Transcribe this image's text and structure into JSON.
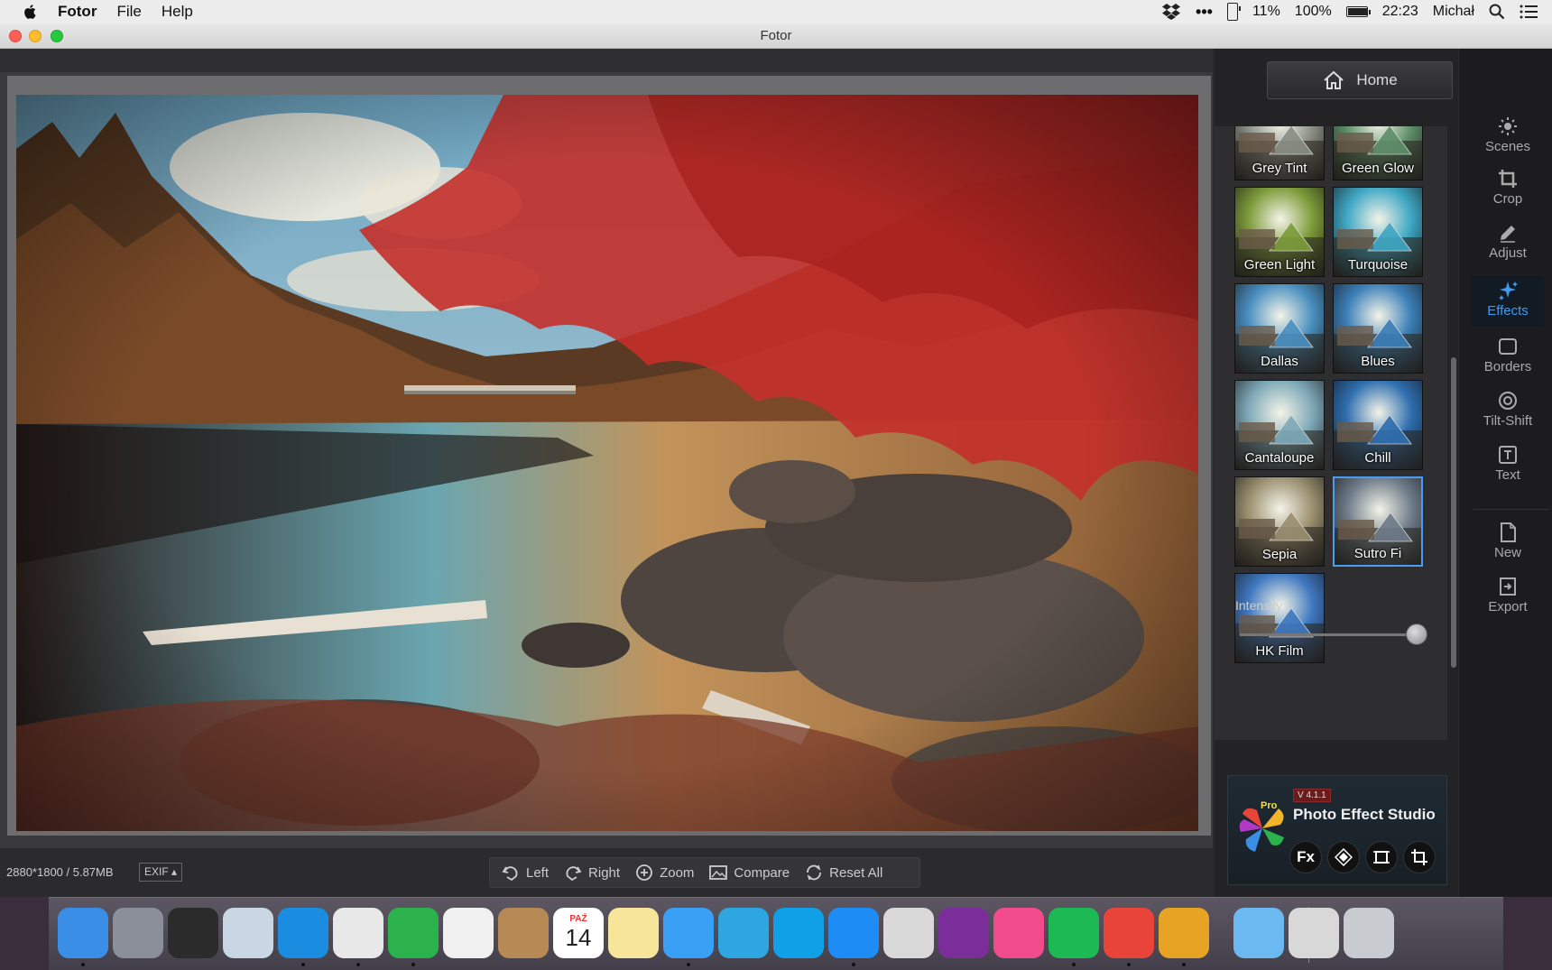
{
  "menubar": {
    "app_name": "Fotor",
    "menus": [
      "File",
      "Help"
    ],
    "battery_small": "11%",
    "battery": "100%",
    "battery_level": 1.0,
    "time": "22:23",
    "user": "Michał"
  },
  "window": {
    "title": "Fotor"
  },
  "status": {
    "image_info": "2880*1800 / 5.87MB",
    "exif_label": "EXIF ▴"
  },
  "tools": [
    {
      "label": "Left",
      "icon": "rotate-left-icon"
    },
    {
      "label": "Right",
      "icon": "rotate-right-icon"
    },
    {
      "label": "Zoom",
      "icon": "zoom-icon"
    },
    {
      "label": "Compare",
      "icon": "compare-icon"
    },
    {
      "label": "Reset All",
      "icon": "reset-icon"
    }
  ],
  "home_button": "Home",
  "effects": [
    {
      "label": "Grey Tint",
      "tint": "#8a8f86"
    },
    {
      "label": "Green Glow",
      "tint": "#5f8f6a"
    },
    {
      "label": "Green Light",
      "tint": "#7d9c3a"
    },
    {
      "label": "Turquoise",
      "tint": "#3fa7c4"
    },
    {
      "label": "Dallas",
      "tint": "#4a8fc0"
    },
    {
      "label": "Blues",
      "tint": "#3b7fb8"
    },
    {
      "label": "Cantaloupe",
      "tint": "#7fa9b8"
    },
    {
      "label": "Chill",
      "tint": "#2f6fb0"
    },
    {
      "label": "Sepia",
      "tint": "#9b9070"
    },
    {
      "label": "Sutro Fi",
      "tint": "#6f7c8a"
    },
    {
      "label": "HK Film",
      "tint": "#3f78c0"
    }
  ],
  "selected_effect": "Sutro Fi",
  "intensity": {
    "label": "Intensity",
    "value": 1.0
  },
  "promo": {
    "version": "V 4.1.1",
    "title": "Photo Effect Studio",
    "fx_label": "Fx"
  },
  "sidebar": [
    {
      "label": "Scenes",
      "icon": "sun-icon"
    },
    {
      "label": "Crop",
      "icon": "crop-icon"
    },
    {
      "label": "Adjust",
      "icon": "pencil-icon"
    },
    {
      "label": "Effects",
      "icon": "sparkle-icon"
    },
    {
      "label": "Borders",
      "icon": "border-icon"
    },
    {
      "label": "Tilt-Shift",
      "icon": "target-icon"
    },
    {
      "label": "Text",
      "icon": "text-icon"
    },
    {
      "label": "New",
      "icon": "document-icon"
    },
    {
      "label": "Export",
      "icon": "export-icon"
    }
  ],
  "active_sidebar": "Effects",
  "dock": {
    "calendar_month": "PAŹ",
    "calendar_day": "14",
    "apps": [
      {
        "name": "finder-icon",
        "color": "#3a8ee6"
      },
      {
        "name": "launchpad-icon",
        "color": "#8a8f99"
      },
      {
        "name": "mission-control-icon",
        "color": "#2b2b2b"
      },
      {
        "name": "mail-icon",
        "color": "#c9d6e3"
      },
      {
        "name": "safari-icon",
        "color": "#1b8de0"
      },
      {
        "name": "chrome-icon",
        "color": "#e8e8e8"
      },
      {
        "name": "feedly-icon",
        "color": "#2bb24c"
      },
      {
        "name": "pocket-icon",
        "color": "#f0f0f0"
      },
      {
        "name": "contacts-icon",
        "color": "#b78a55"
      },
      {
        "name": "calendar-icon",
        "color": "#ffffff"
      },
      {
        "name": "notes-icon",
        "color": "#f7e59a"
      },
      {
        "name": "messages-icon",
        "color": "#3aa0f5"
      },
      {
        "name": "telegram-icon",
        "color": "#2ea6df"
      },
      {
        "name": "skype-icon",
        "color": "#0fa0e8"
      },
      {
        "name": "messenger-icon",
        "color": "#1e8cf5"
      },
      {
        "name": "preview-icon",
        "color": "#d9d9d9"
      },
      {
        "name": "onenote-icon",
        "color": "#7b2e9a"
      },
      {
        "name": "itunes-icon",
        "color": "#f24b8c"
      },
      {
        "name": "spotify-icon",
        "color": "#1db954"
      },
      {
        "name": "downloader-icon",
        "color": "#e8443a"
      },
      {
        "name": "colors-icon",
        "color": "#e6a324"
      },
      {
        "name": "folder-icon",
        "color": "#6cb8f0"
      },
      {
        "name": "downloads-stack-icon",
        "color": "#d8d8d8"
      },
      {
        "name": "trash-icon",
        "color": "#c8ccd0"
      }
    ]
  }
}
